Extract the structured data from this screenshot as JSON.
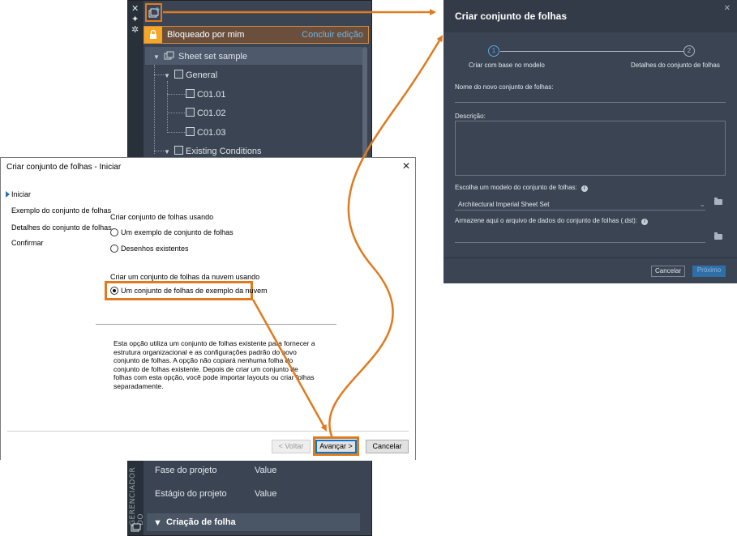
{
  "ssm": {
    "close_glyph": "✕",
    "pin_glyph": "✦",
    "settings_glyph": "✲",
    "vertical_label": "GERENCIADOR DO",
    "locked_text": "Bloqueado por mim",
    "finish_edit_link": "Concluir edição",
    "tree": {
      "root": "Sheet set sample",
      "group1": "General",
      "sheets": [
        "C01.01",
        "C01.02",
        "C01.03"
      ],
      "group2": "Existing Conditions"
    },
    "properties": [
      {
        "name": "Fase do projeto",
        "value": "Value"
      },
      {
        "name": "Estágio do projeto",
        "value": "Value"
      }
    ],
    "section": "Criação de folha"
  },
  "wizard": {
    "title": "Criar conjunto de folhas - Iniciar",
    "close_glyph": "✕",
    "nav": [
      "Iniciar",
      "Exemplo do conjunto de folhas",
      "Detalhes do conjunto de folhas",
      "Confirmar"
    ],
    "create_using_label": "Criar conjunto de folhas usando",
    "option_example": "Um exemplo de conjunto de folhas",
    "option_existing": "Desenhos existentes",
    "cloud_label": "Criar um conjunto de folhas da nuvem usando",
    "option_cloud": "Um conjunto de folhas de exemplo da nuvem",
    "description": "Esta opção utiliza um conjunto de folhas existente para fornecer a estrutura organizacional e as configurações padrão do novo conjunto de folhas. A opção não copiará nenhuma folha do conjunto de folhas existente. Depois de criar um conjunto de folhas com esta opção, você pode importar layouts ou criar folhas separadamente.",
    "buttons": {
      "back": "< Voltar",
      "next": "Avançar >",
      "cancel": "Cancelar"
    }
  },
  "web_dialog": {
    "title": "Criar conjunto de folhas",
    "close_glyph": "✕",
    "steps": [
      {
        "number": "1",
        "label": "Criar com base no modelo"
      },
      {
        "number": "2",
        "label": "Detalhes do conjunto de folhas"
      }
    ],
    "name_label": "Nome do novo conjunto de folhas:",
    "description_label": "Descrição:",
    "template_label": "Escolha um modelo do conjunto de folhas:",
    "template_value": "Architectural Imperial Sheet Set",
    "dst_label": "Armazene aqui o arquivo de dados do conjunto de folhas (.dst):",
    "info_glyph": "i",
    "buttons": {
      "cancel": "Cancelar",
      "next": "Próximo"
    }
  },
  "colors": {
    "highlight": "#e07a1f",
    "dark_panel": "#3b4453",
    "link": "#6fb4e6",
    "lock": "#f5a623"
  }
}
